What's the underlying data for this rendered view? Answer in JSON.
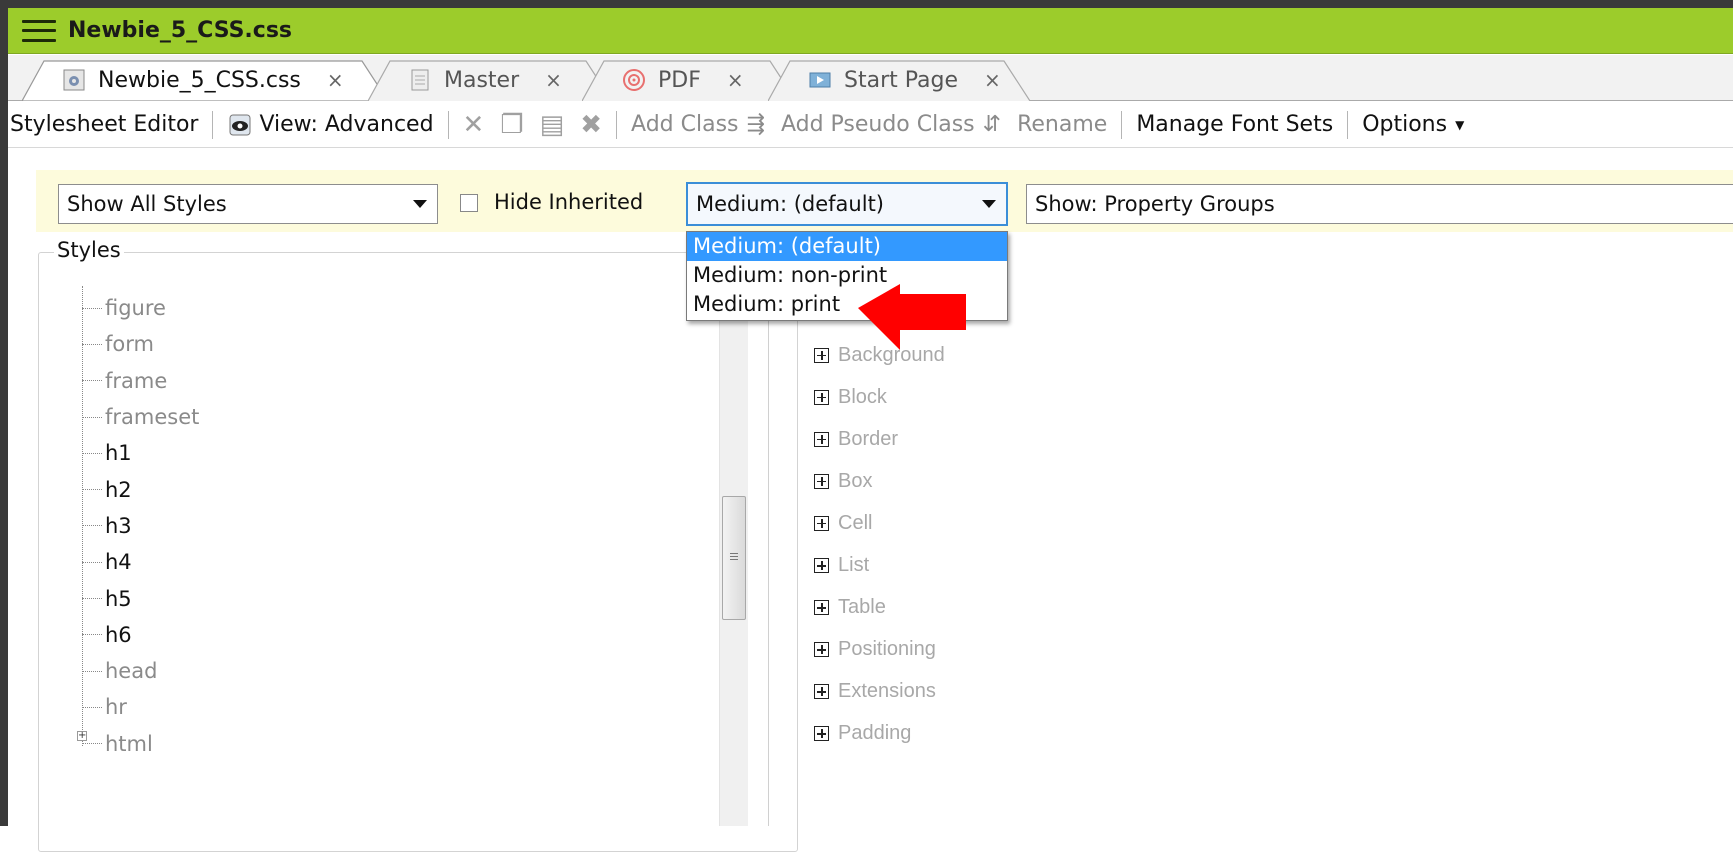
{
  "window": {
    "title": "Newbie_5_CSS.css"
  },
  "tabs": [
    {
      "label": "Newbie_5_CSS.css",
      "close": "×",
      "active": true,
      "icon": "gear-icon"
    },
    {
      "label": "Master",
      "close": "×",
      "active": false,
      "icon": "document-icon"
    },
    {
      "label": "PDF",
      "close": "×",
      "active": false,
      "icon": "target-icon"
    },
    {
      "label": "Start Page",
      "close": "×",
      "active": false,
      "icon": "start-page-icon"
    }
  ],
  "toolbar": {
    "editor_label": "Stylesheet Editor",
    "view_label": "View: Advanced",
    "add_class": "Add Class",
    "add_pseudo_class": "Add Pseudo Class",
    "rename": "Rename",
    "manage_font_sets": "Manage Font Sets",
    "options": "Options"
  },
  "filters": {
    "styles_combo": "Show All Styles",
    "hide_inherited": "Hide Inherited",
    "hide_inherited_checked": false,
    "medium_combo": "Medium: (default)",
    "show_combo": "Show: Property Groups"
  },
  "medium_options": [
    {
      "label": "Medium: (default)",
      "selected": true
    },
    {
      "label": "Medium: non-print",
      "selected": false
    },
    {
      "label": "Medium: print",
      "selected": false
    }
  ],
  "styles_panel": {
    "legend": "Styles",
    "items": [
      {
        "label": "figure",
        "dark": false
      },
      {
        "label": "form",
        "dark": false
      },
      {
        "label": "frame",
        "dark": false
      },
      {
        "label": "frameset",
        "dark": false
      },
      {
        "label": "h1",
        "dark": true
      },
      {
        "label": "h2",
        "dark": true
      },
      {
        "label": "h3",
        "dark": true
      },
      {
        "label": "h4",
        "dark": true
      },
      {
        "label": "h5",
        "dark": true
      },
      {
        "label": "h6",
        "dark": true
      },
      {
        "label": "head",
        "dark": false
      },
      {
        "label": "hr",
        "dark": false
      },
      {
        "label": "html",
        "dark": false
      }
    ]
  },
  "property_groups": [
    "Background",
    "Block",
    "Border",
    "Box",
    "Cell",
    "List",
    "Table",
    "Positioning",
    "Extensions",
    "Padding"
  ],
  "colors": {
    "titlebar": "#9ccc2b",
    "filterbar": "#fdfbdc",
    "selection": "#3399ff",
    "annotation_arrow": "#ff0000"
  }
}
